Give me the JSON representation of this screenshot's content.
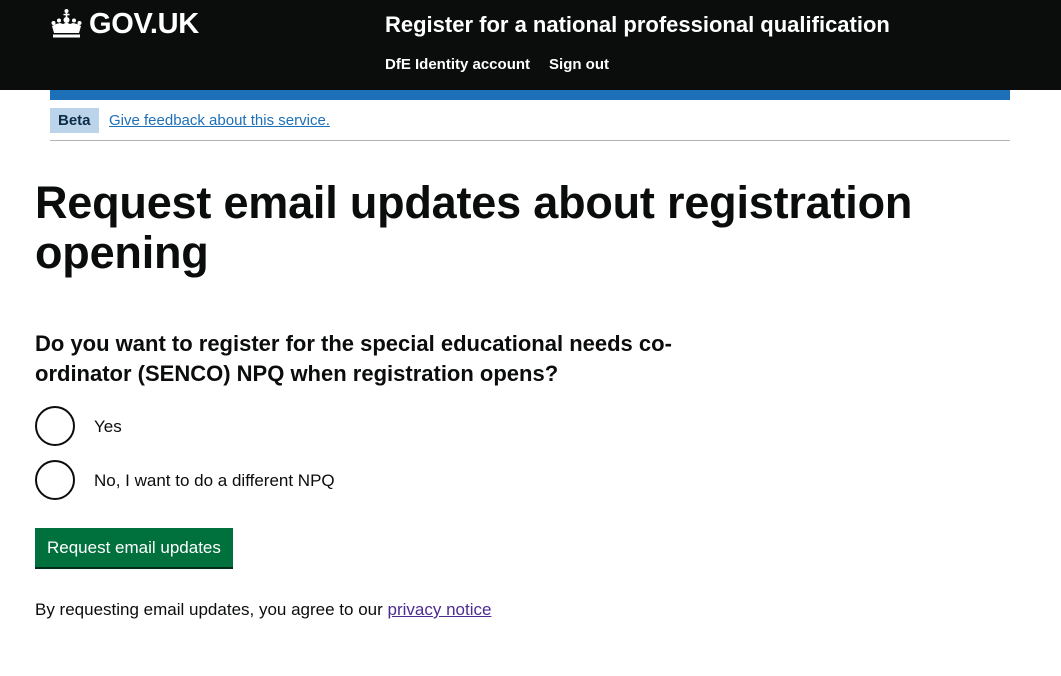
{
  "header": {
    "logo_text": "GOV.UK",
    "service_name": "Register for a national professional qualification",
    "nav": [
      "DfE Identity account",
      "Sign out"
    ]
  },
  "phase_banner": {
    "tag": "Beta",
    "link": "Give feedback about this service."
  },
  "main": {
    "title_line1": "Request email updates about registration",
    "title_line2": "opening",
    "question_line1": "Do you want to register for the special educational needs co-",
    "question_line2": "ordinator (SENCO) NPQ when registration opens?",
    "options": [
      "Yes",
      "No, I want to do a different NPQ"
    ],
    "submit_label": "Request email updates",
    "notice_text": "By requesting email updates, you agree to our ",
    "notice_link": "privacy notice"
  },
  "colors": {
    "header_bg": "#0b0c0c",
    "brand_blue": "#1d70b8",
    "button_green": "#00703c",
    "visited_link": "#4c2c92"
  },
  "icons": [
    "crown-icon"
  ]
}
